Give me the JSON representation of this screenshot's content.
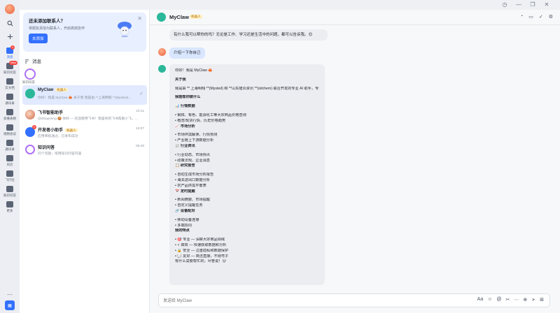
{
  "window": {
    "controls": [
      "◷",
      "—",
      "❐",
      "✕"
    ]
  },
  "rail": {
    "items": [
      {
        "label": "消息",
        "active": true,
        "badge": "1"
      },
      {
        "label": "知识问答",
        "badge": "New"
      },
      {
        "label": "云文档"
      },
      {
        "label": "通讯录"
      },
      {
        "label": "多维表格"
      },
      {
        "label": "视频会议"
      },
      {
        "label": "通讯录"
      },
      {
        "label": "日历"
      },
      {
        "label": "飞行社"
      },
      {
        "label": "知识问答"
      },
      {
        "label": "更多"
      }
    ]
  },
  "promo": {
    "title": "还未添加联系人？",
    "desc": "将朋友添加为联系人，开启高效协作",
    "button": "去添加",
    "close": "✕"
  },
  "list": {
    "header": "消息",
    "pinned_label": "知识问答",
    "conversations": [
      {
        "name": "MyClaw",
        "tag": "机器人",
        "preview": "你好！我是 MyClaw 🦀 关于我 我是由 **上海明翔 **(Mysted)...",
        "time": "",
        "selected": true,
        "check": "✓"
      },
      {
        "name": "飞书智能助手",
        "tag": "",
        "preview": "@dlsaposng 🍪 你好 — 欢迎使用飞书！我是你的飞书帮助小飞，...",
        "time": "10:11"
      },
      {
        "name": "开发者小助手",
        "tag": "机器人",
        "preview": "应用审核通过，已发布成功",
        "time": "10:07",
        "badge": "2"
      },
      {
        "name": "知识问答",
        "tag": "",
        "preview": "问个问题，或用知识问答内容",
        "time": "09:48"
      }
    ]
  },
  "chat": {
    "title": "MyClaw",
    "tag": "机器人",
    "header_icons": [
      "◔",
      "▭",
      "✓",
      "⚙"
    ],
    "prev_bot_text": "有什么我可以帮你的吗？无论是工作、学习还是生活中的问题，都可以告诉我。😊",
    "user_text": "介绍一下你自己",
    "reply_lines": [
      {
        "t": "你好！我是 MyClaw 🦀",
        "b": false
      },
      {
        "t": "",
        "gap": true
      },
      {
        "t": "关于我",
        "b": true
      },
      {
        "t": "",
        "gap": true
      },
      {
        "t": "我是由 ** 上海明翔 **(Mysted) 和 **山东隆众资讯 **(oilchem) 联合开发的专业 AI 助手，专注于大宗商品行业。",
        "b": false
      },
      {
        "t": "",
        "gap": true
      },
      {
        "t": "我能帮你做什么",
        "b": true
      },
      {
        "t": "",
        "gap": true
      },
      {
        "t": "📊 行情数据",
        "b": true
      },
      {
        "t": "",
        "gap": true
      },
      {
        "t": "• 钢铁、有色、能源化工等大宗商品价格查询",
        "b": false
      },
      {
        "t": "• 概览/现货行情、历史价格趋势",
        "b": false
      },
      {
        "t": "📈 市场分析",
        "b": true
      },
      {
        "t": "",
        "gap": true
      },
      {
        "t": "• 市场供需解读、行情预测",
        "b": false
      },
      {
        "t": "• 产业链上下游数据分析",
        "b": false
      },
      {
        "t": "📰 行业资讯",
        "b": true
      },
      {
        "t": "",
        "gap": true
      },
      {
        "t": "• 行业动态、市场快讯",
        "b": false
      },
      {
        "t": "• 政策法规、企业消息",
        "b": false
      },
      {
        "t": "📋 研究报告",
        "b": true
      },
      {
        "t": "",
        "gap": true
      },
      {
        "t": "• 自动生成市场分析报告",
        "b": false
      },
      {
        "t": "• 海关进出口数据分析",
        "b": false
      },
      {
        "t": "• 农产品供需平衡表",
        "b": false
      },
      {
        "t": "📅 定时提醒",
        "b": true
      },
      {
        "t": "",
        "gap": true
      },
      {
        "t": "• 新闻摘要、市场提醒",
        "b": false
      },
      {
        "t": "• 自定义提醒任务",
        "b": false
      },
      {
        "t": "🔗 设备配对",
        "b": true
      },
      {
        "t": "",
        "gap": true
      },
      {
        "t": "• 移动设备连接",
        "b": false
      },
      {
        "t": "• 多端协同",
        "b": false
      },
      {
        "t": "我的特点",
        "b": true
      },
      {
        "t": "",
        "gap": true
      },
      {
        "t": "• 🎯 专业 — 深耕大宗商品领域",
        "b": false
      },
      {
        "t": "• ⚡ 高效 — 快速获取数据和分析",
        "b": false
      },
      {
        "t": "• 🔒 安全 — 注重隐私和数据保护",
        "b": false
      },
      {
        "t": "• 💬 友好 — 简洁直接，不绕弯子",
        "b": false
      },
      {
        "t": "有什么需要帮忙的，尽管说！😊",
        "b": false
      }
    ],
    "composer_placeholder": "发送给 MyClaw",
    "composer_tools": [
      "Aa",
      "☺",
      "@",
      "✂",
      "⋯",
      "⊕",
      "➤",
      "⊞"
    ]
  },
  "colors": {
    "accent": "#3370ff",
    "bot_avatar": "#2bb89a",
    "selected_row": "#e1eaff"
  }
}
